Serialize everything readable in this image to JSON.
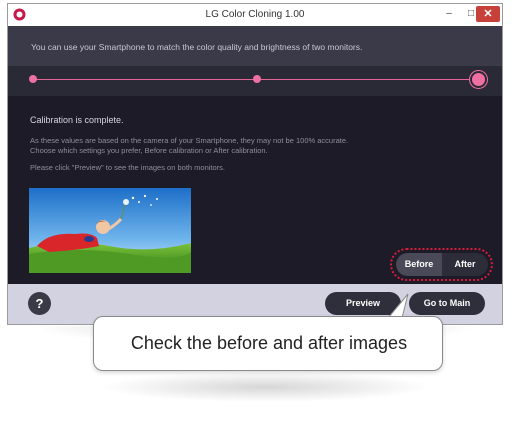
{
  "window": {
    "title": "LG Color Cloning 1.00",
    "controls": {
      "minimize": "–",
      "maximize": "□",
      "close": "✕"
    }
  },
  "info": {
    "text": "You can use your Smartphone to match the color quality and brightness of two monitors."
  },
  "progress": {
    "steps_total": 3,
    "current_step": 3,
    "accent_color": "#ee6fa2"
  },
  "content": {
    "complete": "Calibration is complete.",
    "note_line1": "As these values are based on the camera of your Smartphone, they may not be 100% accurate.",
    "note_line2": "Choose which settings you prefer, Before calibration or After calibration.",
    "preview_hint": "Please click \"Preview\" to see the images on both monitors.",
    "image_alt": "child blowing dandelion seeds on grass"
  },
  "toggle": {
    "before_label": "Before",
    "after_label": "After",
    "selected": "Before",
    "highlight_color": "#d91c3d"
  },
  "footer": {
    "help_label": "?",
    "preview_label": "Preview",
    "main_label": "Go to Main"
  },
  "callout": {
    "text": "Check the before and after images"
  }
}
